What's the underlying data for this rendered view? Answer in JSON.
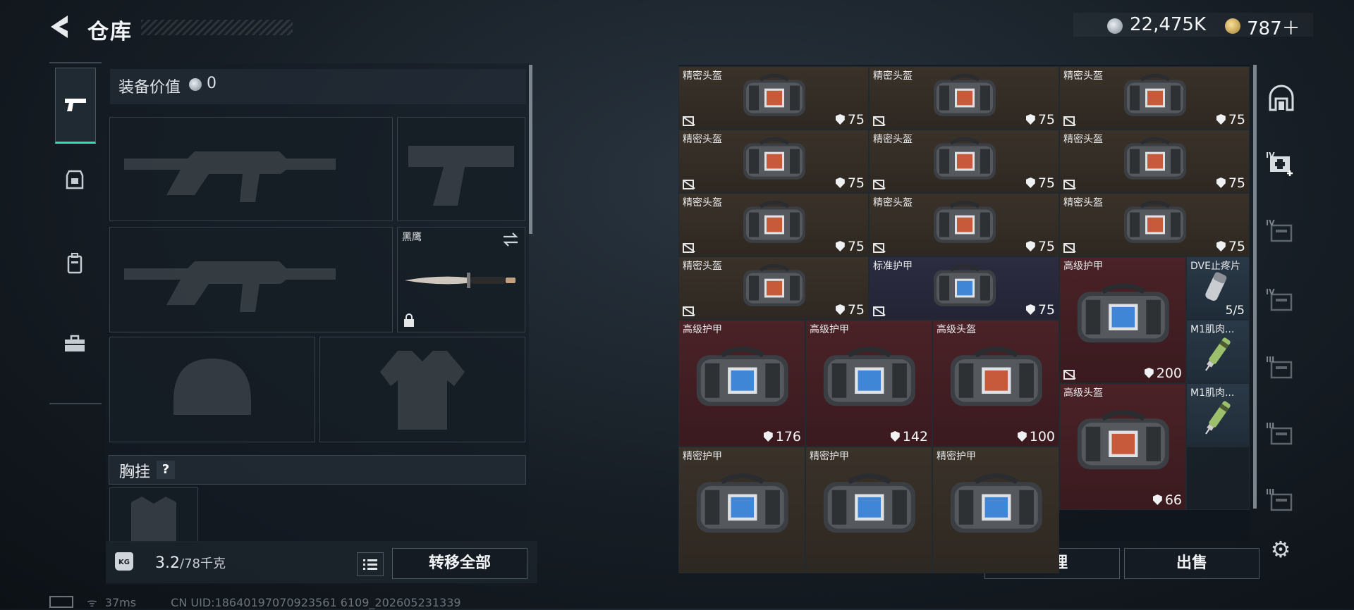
{
  "header": {
    "title": "仓库"
  },
  "currency": {
    "money": "22,475K",
    "gold": "787＋"
  },
  "left_nav": [
    "pistol-icon",
    "armor-icon",
    "backpack-icon",
    "toolbox-icon"
  ],
  "equipment": {
    "value_label": "装备价值",
    "value": "0",
    "melee_label": "黑鹰",
    "vest_label": "胸挂",
    "vest_help": "?"
  },
  "weight": {
    "current": "3.2",
    "max": "/78千克",
    "icon_label": "KG"
  },
  "buttons": {
    "transfer_all": "转移全部",
    "sort": "整理",
    "sell": "出售"
  },
  "status": {
    "ping": "37ms",
    "uid": "CN UID:18640197070923561 6109_202605231339"
  },
  "storage": {
    "items": [
      {
        "name": "精密头盔",
        "dur": "75",
        "tier": "brown",
        "icon": "helmet"
      },
      {
        "name": "精密头盔",
        "dur": "75",
        "tier": "brown",
        "icon": "helmet"
      },
      {
        "name": "精密头盔",
        "dur": "75",
        "tier": "brown",
        "icon": "helmet"
      },
      {
        "name": "精密头盔",
        "dur": "75",
        "tier": "brown",
        "icon": "helmet"
      },
      {
        "name": "精密头盔",
        "dur": "75",
        "tier": "brown",
        "icon": "helmet"
      },
      {
        "name": "精密头盔",
        "dur": "75",
        "tier": "brown",
        "icon": "helmet"
      },
      {
        "name": "精密头盔",
        "dur": "75",
        "tier": "brown",
        "icon": "helmet"
      },
      {
        "name": "精密头盔",
        "dur": "75",
        "tier": "brown",
        "icon": "helmet"
      },
      {
        "name": "精密头盔",
        "dur": "75",
        "tier": "brown",
        "icon": "helmet"
      },
      {
        "name": "精密头盔",
        "dur": "75",
        "tier": "brown",
        "icon": "helmet"
      },
      {
        "name": "标准护甲",
        "dur": "75",
        "tier": "purple",
        "icon": "armor"
      },
      {
        "name": "高级护甲",
        "dur": "200",
        "tier": "red",
        "icon": "armor"
      },
      {
        "name": "DVE止疼片",
        "stack": "5/5",
        "tier": "blue",
        "icon": "pill"
      },
      {
        "name": "高级护甲",
        "dur": "176",
        "tier": "red",
        "icon": "armor"
      },
      {
        "name": "高级护甲",
        "dur": "142",
        "tier": "red",
        "icon": "armor"
      },
      {
        "name": "高级头盔",
        "dur": "100",
        "tier": "red",
        "icon": "helmet"
      },
      {
        "name": "M1肌肉...",
        "tier": "blue",
        "icon": "syringe"
      },
      {
        "name": "高级头盔",
        "dur": "66",
        "tier": "red",
        "icon": "helmet"
      },
      {
        "name": "M1肌肉...",
        "tier": "blue",
        "icon": "syringe"
      },
      {
        "name": "精密护甲",
        "tier": "brown",
        "icon": "armor"
      },
      {
        "name": "精密护甲",
        "tier": "brown",
        "icon": "armor"
      },
      {
        "name": "精密护甲",
        "tier": "brown",
        "icon": "armor"
      }
    ]
  },
  "right_nav": [
    {
      "icon": "all-items-icon",
      "tier": ""
    },
    {
      "icon": "medkit-add-icon",
      "tier": "IV"
    },
    {
      "icon": "container-icon",
      "tier": "IV"
    },
    {
      "icon": "container-icon",
      "tier": "IV"
    },
    {
      "icon": "container-icon",
      "tier": "III"
    },
    {
      "icon": "container-icon",
      "tier": "III"
    },
    {
      "icon": "container-icon",
      "tier": "III"
    }
  ],
  "colors": {
    "accent": "#2ee3b3",
    "brown": "#3a3229",
    "purple": "#2b2c40",
    "red": "#4a2227",
    "blue": "#2a3947"
  }
}
